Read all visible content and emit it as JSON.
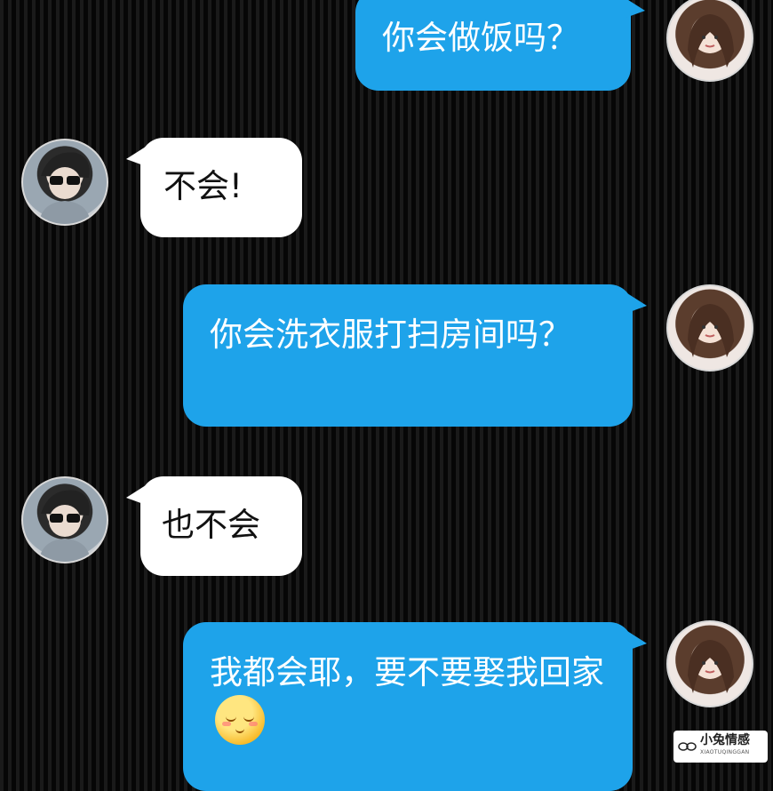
{
  "messages": [
    {
      "side": "right",
      "text": "你会做饭吗？"
    },
    {
      "side": "left",
      "text": "不会!"
    },
    {
      "side": "right",
      "text": "你会洗衣服打扫房间吗？"
    },
    {
      "side": "left",
      "text": "也不会"
    },
    {
      "side": "right",
      "text": "我都会耶，要不要娶我回家",
      "emoji": "blushing-smile-emoji"
    }
  ],
  "watermark": {
    "title": "小兔情感",
    "subtitle": "XIAOTUQINGGAN"
  },
  "colors": {
    "sent_bubble": "#1ea3ea",
    "received_bubble": "#ffffff",
    "background": "#0b0b0b"
  }
}
